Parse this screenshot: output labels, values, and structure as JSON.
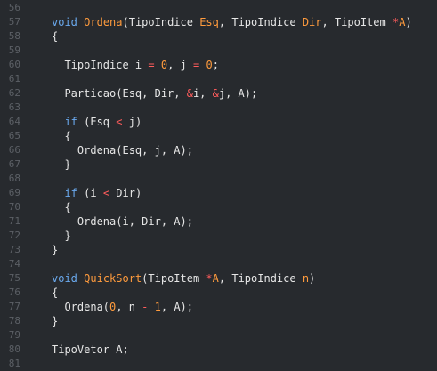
{
  "editor": {
    "lines": [
      {
        "num": "56",
        "tokens": []
      },
      {
        "num": "57",
        "tokens": [
          {
            "t": "void",
            "c": "kw"
          },
          {
            "t": " ",
            "c": "p"
          },
          {
            "t": "Ordena",
            "c": "fn"
          },
          {
            "t": "(TipoIndice ",
            "c": "p"
          },
          {
            "t": "Esq",
            "c": "nm"
          },
          {
            "t": ", TipoIndice ",
            "c": "p"
          },
          {
            "t": "Dir",
            "c": "nm"
          },
          {
            "t": ", TipoItem ",
            "c": "p"
          },
          {
            "t": "*",
            "c": "op"
          },
          {
            "t": "A",
            "c": "nm"
          },
          {
            "t": ")",
            "c": "p"
          }
        ]
      },
      {
        "num": "58",
        "tokens": [
          {
            "t": "{",
            "c": "p"
          }
        ]
      },
      {
        "num": "59",
        "tokens": []
      },
      {
        "num": "60",
        "tokens": [
          {
            "t": "  TipoIndice i ",
            "c": "p"
          },
          {
            "t": "=",
            "c": "op"
          },
          {
            "t": " ",
            "c": "p"
          },
          {
            "t": "0",
            "c": "nm"
          },
          {
            "t": ", j ",
            "c": "p"
          },
          {
            "t": "=",
            "c": "op"
          },
          {
            "t": " ",
            "c": "p"
          },
          {
            "t": "0",
            "c": "nm"
          },
          {
            "t": ";",
            "c": "p"
          }
        ]
      },
      {
        "num": "61",
        "tokens": []
      },
      {
        "num": "62",
        "tokens": [
          {
            "t": "  Particao(Esq, Dir, ",
            "c": "p"
          },
          {
            "t": "&",
            "c": "op"
          },
          {
            "t": "i, ",
            "c": "p"
          },
          {
            "t": "&",
            "c": "op"
          },
          {
            "t": "j, A);",
            "c": "p"
          }
        ]
      },
      {
        "num": "63",
        "tokens": []
      },
      {
        "num": "64",
        "tokens": [
          {
            "t": "  ",
            "c": "p"
          },
          {
            "t": "if",
            "c": "kw"
          },
          {
            "t": " (Esq ",
            "c": "p"
          },
          {
            "t": "<",
            "c": "op"
          },
          {
            "t": " j)",
            "c": "p"
          }
        ]
      },
      {
        "num": "65",
        "tokens": [
          {
            "t": "  {",
            "c": "p"
          }
        ]
      },
      {
        "num": "66",
        "tokens": [
          {
            "t": "    Ordena(Esq, j, A);",
            "c": "p"
          }
        ]
      },
      {
        "num": "67",
        "tokens": [
          {
            "t": "  }",
            "c": "p"
          }
        ]
      },
      {
        "num": "68",
        "tokens": []
      },
      {
        "num": "69",
        "tokens": [
          {
            "t": "  ",
            "c": "p"
          },
          {
            "t": "if",
            "c": "kw"
          },
          {
            "t": " (i ",
            "c": "p"
          },
          {
            "t": "<",
            "c": "op"
          },
          {
            "t": " Dir)",
            "c": "p"
          }
        ]
      },
      {
        "num": "70",
        "tokens": [
          {
            "t": "  {",
            "c": "p"
          }
        ]
      },
      {
        "num": "71",
        "tokens": [
          {
            "t": "    Ordena(i, Dir, A);",
            "c": "p"
          }
        ]
      },
      {
        "num": "72",
        "tokens": [
          {
            "t": "  }",
            "c": "p"
          }
        ]
      },
      {
        "num": "73",
        "tokens": [
          {
            "t": "}",
            "c": "p"
          }
        ]
      },
      {
        "num": "74",
        "tokens": []
      },
      {
        "num": "75",
        "tokens": [
          {
            "t": "void",
            "c": "kw"
          },
          {
            "t": " ",
            "c": "p"
          },
          {
            "t": "QuickSort",
            "c": "fn"
          },
          {
            "t": "(TipoItem ",
            "c": "p"
          },
          {
            "t": "*",
            "c": "op"
          },
          {
            "t": "A",
            "c": "nm"
          },
          {
            "t": ", TipoIndice ",
            "c": "p"
          },
          {
            "t": "n",
            "c": "nm"
          },
          {
            "t": ")",
            "c": "p"
          }
        ]
      },
      {
        "num": "76",
        "tokens": [
          {
            "t": "{",
            "c": "p"
          }
        ]
      },
      {
        "num": "77",
        "tokens": [
          {
            "t": "  Ordena(",
            "c": "p"
          },
          {
            "t": "0",
            "c": "nm"
          },
          {
            "t": ", n ",
            "c": "p"
          },
          {
            "t": "-",
            "c": "op"
          },
          {
            "t": " ",
            "c": "p"
          },
          {
            "t": "1",
            "c": "nm"
          },
          {
            "t": ", A);",
            "c": "p"
          }
        ]
      },
      {
        "num": "78",
        "tokens": [
          {
            "t": "}",
            "c": "p"
          }
        ]
      },
      {
        "num": "79",
        "tokens": []
      },
      {
        "num": "80",
        "tokens": [
          {
            "t": "TipoVetor A;",
            "c": "p"
          }
        ]
      },
      {
        "num": "81",
        "tokens": []
      }
    ]
  }
}
